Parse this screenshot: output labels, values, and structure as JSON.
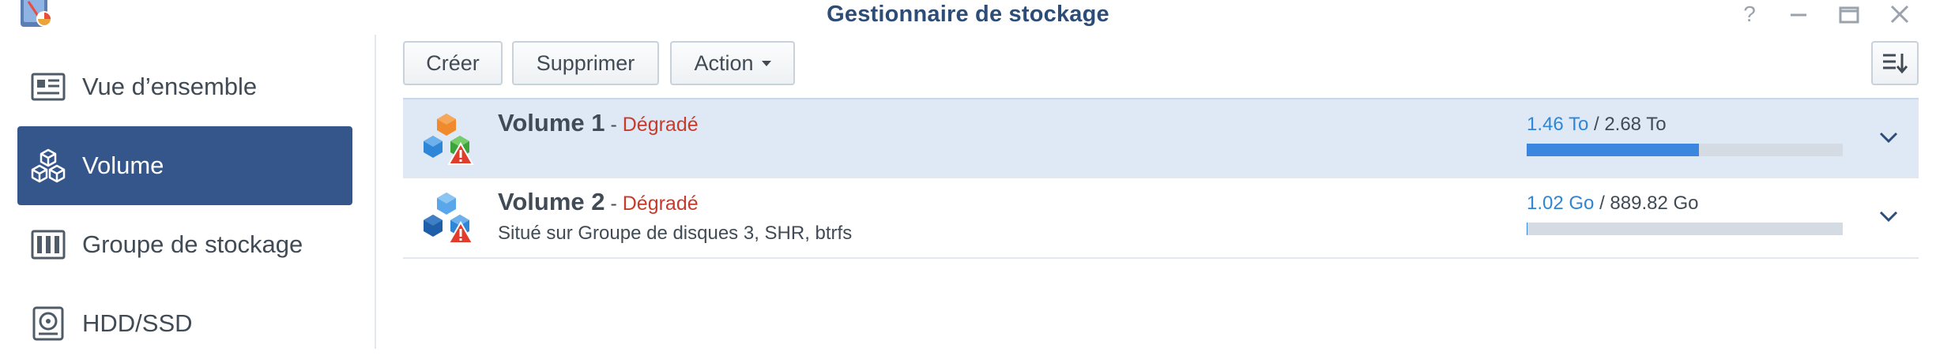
{
  "window": {
    "title": "Gestionnaire de stockage",
    "help_label": "?"
  },
  "sidebar": {
    "items": [
      {
        "label": "Vue d’ensemble",
        "icon": "overview-icon",
        "active": false
      },
      {
        "label": "Volume",
        "icon": "volume-icon",
        "active": true
      },
      {
        "label": "Groupe de stockage",
        "icon": "storage-pool-icon",
        "active": false
      },
      {
        "label": "HDD/SSD",
        "icon": "hdd-icon",
        "active": false
      }
    ]
  },
  "toolbar": {
    "create_label": "Créer",
    "delete_label": "Supprimer",
    "action_label": "Action"
  },
  "volumes": [
    {
      "name": "Volume 1",
      "separator": " - ",
      "status": "Dégradé",
      "description": "",
      "used": "1.46 To",
      "total": "2.68 To",
      "usage_fraction": 0.545,
      "selected": true
    },
    {
      "name": "Volume 2",
      "separator": " - ",
      "status": "Dégradé",
      "description": "Situé sur Groupe de disques 3, SHR, btrfs",
      "used": "1.02 Go",
      "total": "889.82 Go",
      "usage_fraction": 0.001,
      "selected": false
    }
  ],
  "colors": {
    "accent": "#34568a",
    "title": "#2d4d78",
    "warning": "#c83a2a",
    "usage_used": "#2f86d6",
    "bar_fill": "#3b86de"
  }
}
